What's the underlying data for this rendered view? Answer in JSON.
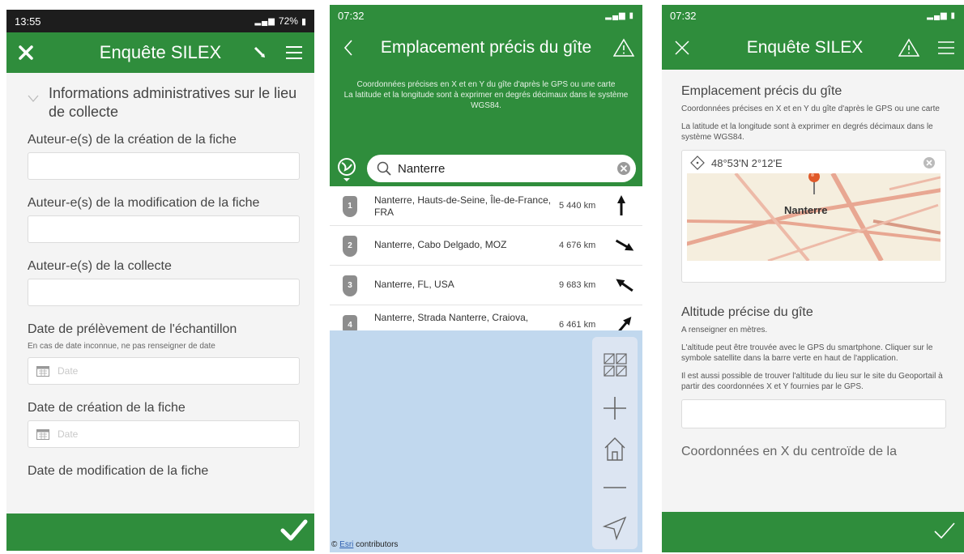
{
  "panel1": {
    "status": {
      "time": "13:55",
      "right": "72%"
    },
    "appbar": {
      "title": "Enquête SILEX"
    },
    "form": {
      "group_title": "Informations administratives sur le lieu de collecte",
      "q1": "Auteur-e(s) de la création de la fiche",
      "q2": "Auteur-e(s) de la modification de la fiche",
      "q3": "Auteur-e(s) de la collecte",
      "q4": "Date de prélèvement de l'échantillon",
      "q4_hint": "En cas de date inconnue, ne pas renseigner de date",
      "q4_placeholder": "Date",
      "q5": "Date de création de la fiche",
      "q5_placeholder": "Date",
      "q6": "Date de modification de la fiche"
    }
  },
  "panel2": {
    "status": {
      "time": "07:32"
    },
    "appbar": {
      "title": "Emplacement précis du gîte"
    },
    "info": [
      "Coordonnées précises en X et en Y du gîte d'après le GPS ou une carte",
      "La latitude et la longitude sont à exprimer en degrés décimaux dans le système WGS84."
    ],
    "search": {
      "value": "Nanterre"
    },
    "results": [
      {
        "num": "1",
        "place": "Nanterre, Hauts-de-Seine, Île-de-France, FRA",
        "dist": "5 440 km"
      },
      {
        "num": "2",
        "place": "Nanterre, Cabo Delgado, MOZ",
        "dist": "4 676 km"
      },
      {
        "num": "3",
        "place": "Nanterre, FL, USA",
        "dist": "9 683 km"
      },
      {
        "num": "4",
        "place": "Nanterre, Strada Nanterre, Craiova,",
        "dist": "6 461 km"
      }
    ],
    "attribution": {
      "link": "Esri",
      "text": " contributors"
    }
  },
  "panel3": {
    "status": {
      "time": "07:32"
    },
    "appbar": {
      "title": "Enquête SILEX"
    },
    "q1": {
      "title": "Emplacement précis du gîte",
      "hint1": "Coordonnées précises en X et en Y du gîte d'après le GPS ou une carte",
      "hint2": "La latitude et la longitude sont à exprimer en degrés décimaux dans le système WGS84.",
      "coords": "48°53'N 2°12'E",
      "map_label": "Nanterre"
    },
    "q2": {
      "title": "Altitude précise du gîte",
      "hint1": "A renseigner en mètres.",
      "hint2": "L'altitude peut être trouvée avec le GPS du smartphone. Cliquer sur le symbole satellite dans la barre verte en haut de l'application.",
      "hint3": "Il est aussi possible de trouver l'altitude du lieu sur le site du Geoportail à partir des coordonnées X et Y fournies par le GPS."
    },
    "q3_partial": "Coordonnées en X du centroïde de la"
  }
}
